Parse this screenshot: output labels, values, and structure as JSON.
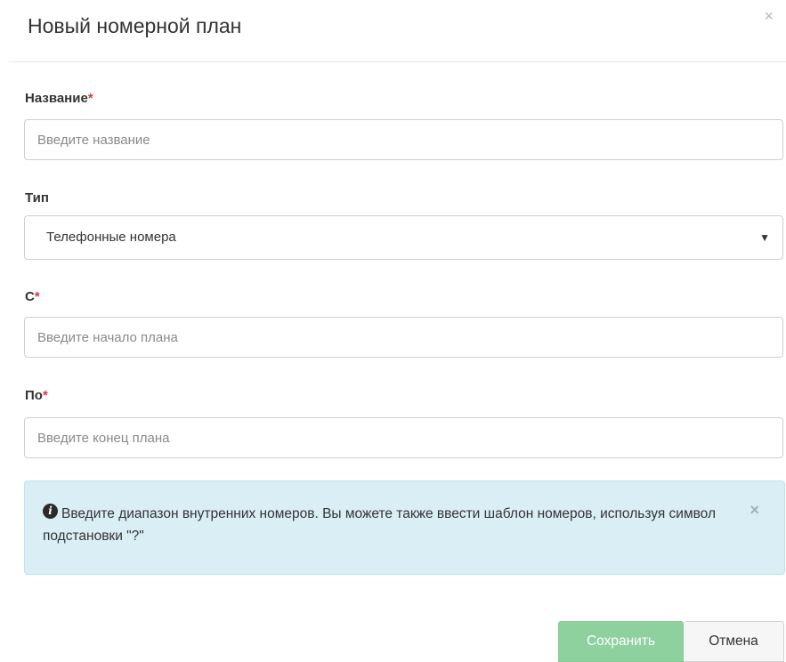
{
  "header": {
    "title": "Новый номерной план",
    "close_glyph": "×"
  },
  "form": {
    "name": {
      "label": "Название",
      "required_mark": "*",
      "placeholder": "Введите название",
      "value": ""
    },
    "type": {
      "label": "Тип",
      "selected": "Телефонные номера",
      "arrow_glyph": "▼"
    },
    "from": {
      "label": "С",
      "required_mark": "*",
      "placeholder": "Введите начало плана",
      "value": ""
    },
    "to": {
      "label": "По",
      "required_mark": "*",
      "placeholder": "Введите конец плана",
      "value": ""
    }
  },
  "alert": {
    "icon": "info-circle-icon",
    "icon_glyph": "i",
    "text": "Введите диапазон внутренних номеров. Вы можете также ввести шаблон номеров, используя символ подстановки \"?\"",
    "close_glyph": "×"
  },
  "footer": {
    "save_label": "Сохранить",
    "cancel_label": "Отмена"
  },
  "colors": {
    "required": "#d9363e",
    "alert_background": "#d9eef5",
    "save_button": "#8fd19e"
  }
}
